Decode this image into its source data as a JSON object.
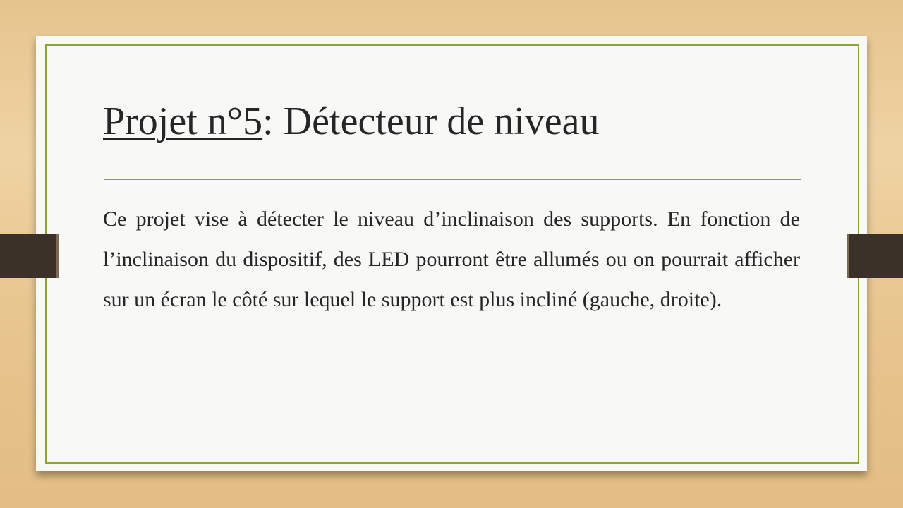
{
  "slide": {
    "title_underlined": "Projet n°5",
    "title_rest": ": Détecteur de niveau",
    "body": "Ce projet vise à détecter le niveau d’inclinaison des supports. En fonction de l’inclinaison du dispositif, des LED pourront être allumés ou on pourrait afficher sur un écran le côté sur lequel le support est plus incliné (gauche, droite)."
  },
  "colors": {
    "accent": "#8fa23a",
    "strap": "#3b3128",
    "text": "#262626"
  }
}
